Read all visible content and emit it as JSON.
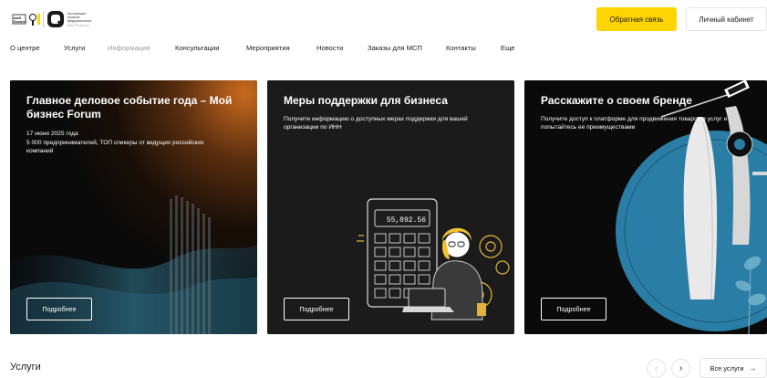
{
  "header": {
    "logo_left_text": "мой бизнес",
    "logo_org_lines": [
      "Ассоциация",
      "отрасли",
      "федеральности"
    ],
    "logo_org_sub": "Моя Разметка",
    "feedback_label": "Обратная связь",
    "cabinet_label": "Личный кабинет",
    "accent_color": "#ffd400"
  },
  "nav": {
    "items": [
      {
        "label": "О центре",
        "active": false
      },
      {
        "label": "Услуги",
        "active": false
      },
      {
        "label": "Информация",
        "active": true
      },
      {
        "label": "Консультации",
        "active": false
      },
      {
        "label": "Мероприятия",
        "active": false
      },
      {
        "label": "Новости",
        "active": false
      },
      {
        "label": "Заказы для МСП",
        "active": false
      },
      {
        "label": "Контакты",
        "active": false
      },
      {
        "label": "Еще",
        "active": false
      }
    ]
  },
  "cards": [
    {
      "title": "Главное деловое событие года – Мой бизнес Forum",
      "lines": [
        "17 июня 2025 года",
        "5 000 предпринимателей, ТОП спикеры от ведущих российских компаний"
      ],
      "button": "Подробнее"
    },
    {
      "title": "Меры поддержки для бизнеса",
      "lines": [
        "Получите информацию о доступных мерах поддержки для вашей организации по ИНН"
      ],
      "button": "Подробнее",
      "calculator_display": "55,892.56"
    },
    {
      "title": "Расскажите о своем бренде",
      "lines": [
        "Получите доступ к платформе для продвижения товаров и услуг и попытайтесь ее преимуществами"
      ],
      "button": "Подробнее"
    }
  ],
  "services": {
    "title": "Услуги",
    "all_label": "Все услуги",
    "prev_icon": "chevron-left-icon",
    "next_icon": "chevron-right-icon"
  }
}
